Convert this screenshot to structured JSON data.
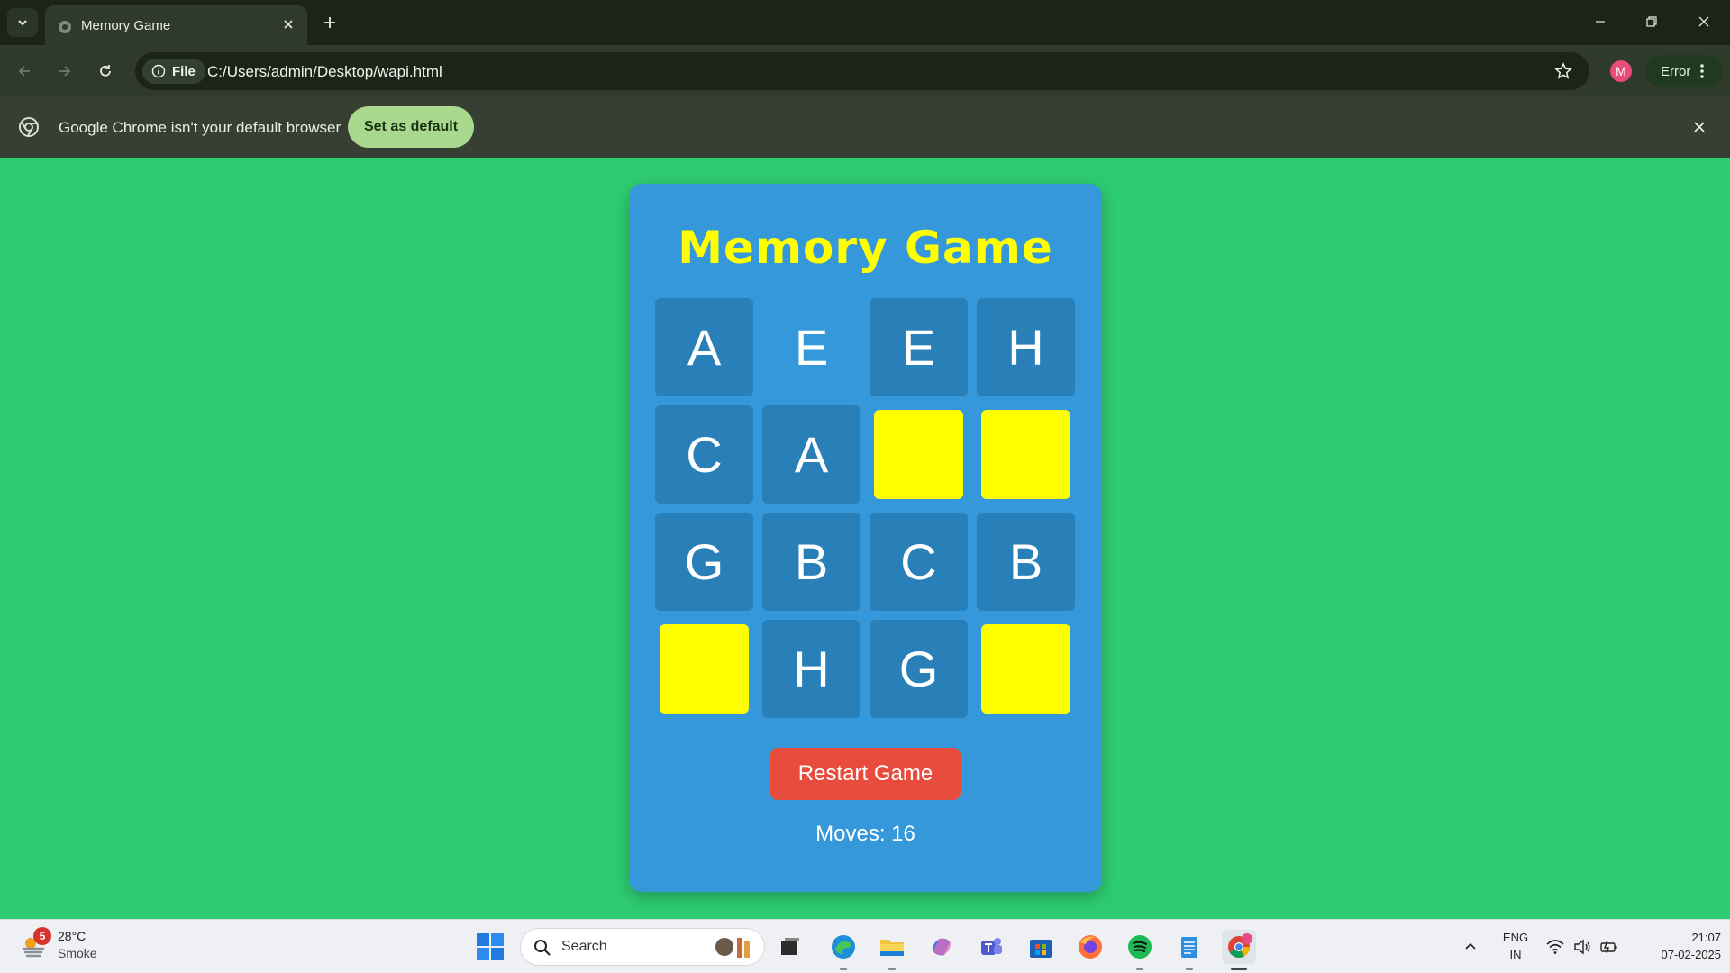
{
  "browser": {
    "tab_title": "Memory Game",
    "url": "C:/Users/admin/Desktop/wapi.html",
    "site_chip_label": "File",
    "profile_initial": "M",
    "error_label": "Error",
    "infobar_message": "Google Chrome isn't your default browser",
    "set_default_label": "Set as default"
  },
  "game": {
    "title": "Memory Game",
    "cells": [
      {
        "value": "A",
        "state": "face-up"
      },
      {
        "value": "E",
        "state": "matched"
      },
      {
        "value": "E",
        "state": "face-up"
      },
      {
        "value": "H",
        "state": "face-up"
      },
      {
        "value": "C",
        "state": "face-up"
      },
      {
        "value": "A",
        "state": "face-up"
      },
      {
        "value": "",
        "state": "hidden"
      },
      {
        "value": "",
        "state": "hidden"
      },
      {
        "value": "G",
        "state": "face-up"
      },
      {
        "value": "B",
        "state": "face-up"
      },
      {
        "value": "C",
        "state": "face-up"
      },
      {
        "value": "B",
        "state": "face-up"
      },
      {
        "value": "",
        "state": "hidden"
      },
      {
        "value": "H",
        "state": "face-up"
      },
      {
        "value": "G",
        "state": "face-up"
      },
      {
        "value": "",
        "state": "hidden"
      }
    ],
    "restart_label": "Restart Game",
    "moves_text": "Moves: 16"
  },
  "colors": {
    "page_background": "#2ecc71",
    "card_background": "#3498db",
    "tile_face": "#2980b9",
    "tile_hidden": "#ffff00",
    "title": "#ffff00",
    "restart_button": "#e74c3c"
  },
  "taskbar": {
    "weather_badge": "5",
    "weather_temp": "28°C",
    "weather_desc": "Smoke",
    "search_placeholder": "Search",
    "lang_line1": "ENG",
    "lang_line2": "IN",
    "time": "21:07",
    "date": "07-02-2025",
    "apps": [
      "task-view",
      "edge",
      "file-explorer",
      "copilot",
      "teams",
      "microsoft-store",
      "firefox",
      "spotify",
      "notepad",
      "chrome"
    ]
  }
}
